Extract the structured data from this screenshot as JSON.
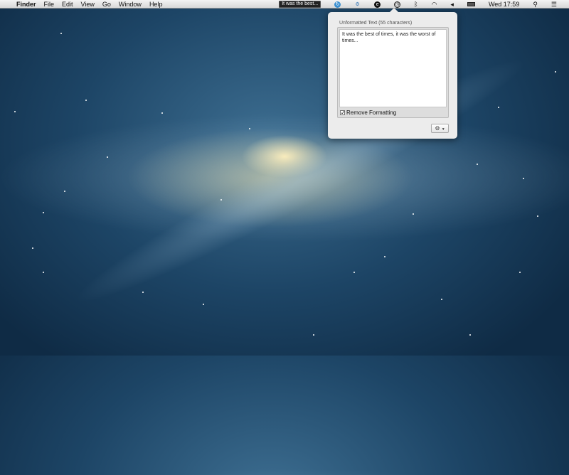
{
  "menubar": {
    "apple": "",
    "app": "Finder",
    "items": [
      "File",
      "Edit",
      "View",
      "Go",
      "Window",
      "Help"
    ],
    "status_text": "It was the best...",
    "clock": "Wed 17:59"
  },
  "popover": {
    "label": "Unformatted Text (55 characters)",
    "text": "It was the best of times, it was the worst of times...",
    "checkbox_label": "Remove Formatting",
    "checkbox_checked": true,
    "gear_icon": "gear-icon"
  }
}
